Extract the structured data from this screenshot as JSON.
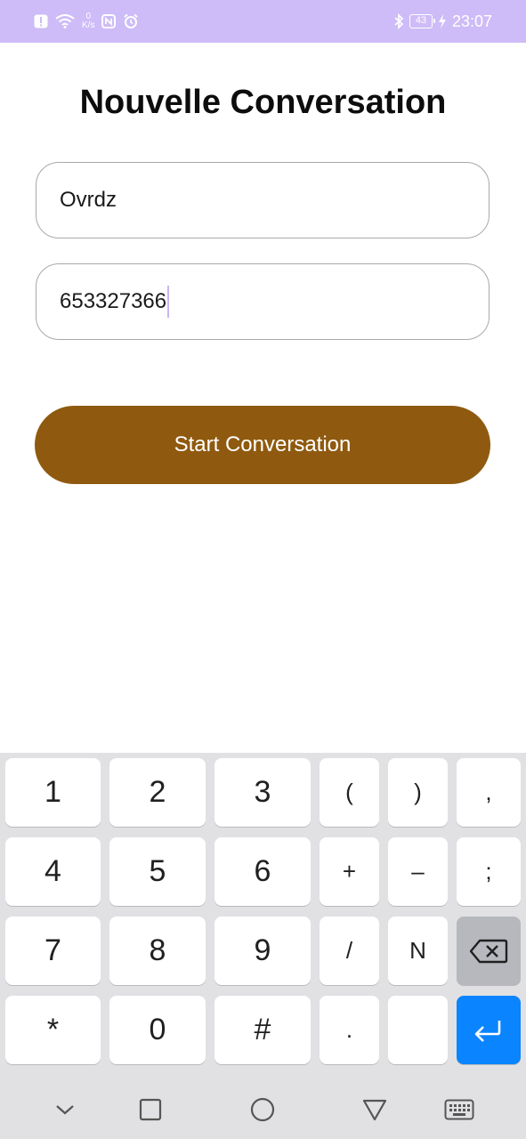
{
  "status_bar": {
    "net_speed_value": "0",
    "net_speed_unit": "K/s",
    "battery": "43",
    "time": "23:07",
    "icons": [
      "alert-icon",
      "wifi-icon",
      "nfc-icon",
      "alarm-icon",
      "bluetooth-icon",
      "battery-icon",
      "charging-icon"
    ]
  },
  "page": {
    "title": "Nouvelle Conversation"
  },
  "form": {
    "name_value": "Ovrdz",
    "phone_value": "653327366",
    "start_label": "Start Conversation"
  },
  "colors": {
    "status_bar": "#cdbcf7",
    "button": "#8f5a0f",
    "enter_key": "#0a84ff"
  },
  "keyboard": {
    "keys": {
      "k1": "1",
      "k2": "2",
      "k3": "3",
      "lparen": "(",
      "rparen": ")",
      "comma": ",",
      "k4": "4",
      "k5": "5",
      "k6": "6",
      "plus": "+",
      "minus": "–",
      "semicolon": ";",
      "k7": "7",
      "k8": "8",
      "k9": "9",
      "slash": "/",
      "n": "N",
      "star": "*",
      "k0": "0",
      "hash": "#",
      "dot": "."
    },
    "icons": [
      "backspace-icon",
      "enter-icon"
    ]
  },
  "nav_bar": {
    "icons": [
      "hide-keyboard-icon",
      "recent-apps-icon",
      "home-icon",
      "back-icon",
      "keyboard-icon"
    ]
  }
}
